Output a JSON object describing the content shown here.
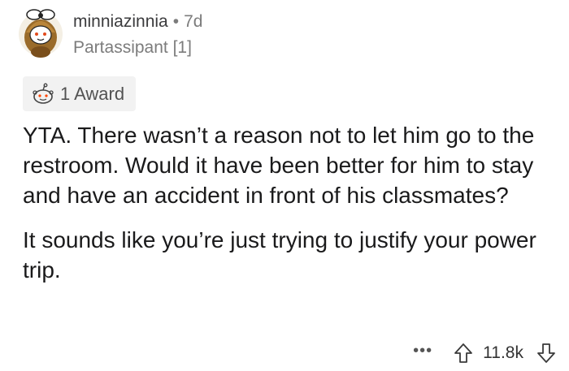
{
  "comment": {
    "author": "minniazinnia",
    "separator": "•",
    "age": "7d",
    "flair": "Partassipant [1]",
    "awards_label": "1 Award",
    "paragraphs": [
      "YTA. There wasn’t a reason not to let him go to the restroom. Would it have been better for him to stay and have an accident in front of his classmates?",
      "It sounds like you’re just trying to justify your power trip."
    ],
    "more_label": "•••",
    "score": "11.8k"
  },
  "icons": {
    "avatar": "snoo-avatar-icon",
    "award": "award-icon",
    "upvote": "upvote-arrow-icon",
    "downvote": "downvote-arrow-icon",
    "more": "more-options-icon"
  },
  "colors": {
    "text": "#1a1a1b",
    "muted": "#7c7c7c",
    "pill_bg": "#f2f2f2"
  }
}
